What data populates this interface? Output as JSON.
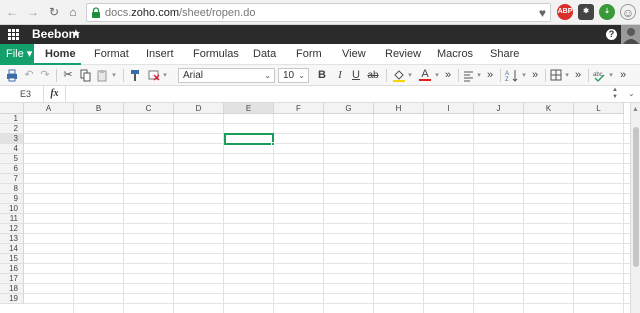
{
  "browser": {
    "url_prefix": "docs.",
    "url_host": "zoho.com",
    "url_path": "/sheet/ropen.do",
    "ext_abp": "ABP"
  },
  "app": {
    "workbook_name": "Beebom",
    "help_label": "?"
  },
  "menu": {
    "file_label": "File ▾",
    "tabs": [
      "Home",
      "Format",
      "Insert",
      "Formulas",
      "Data",
      "Form",
      "View",
      "Review",
      "Macros",
      "Share"
    ],
    "active_tab": "Home"
  },
  "toolbar": {
    "font_name": "Arial",
    "font_size": "10",
    "bold": "B",
    "italic": "I",
    "underline": "U",
    "strike": "ab",
    "font_color": "A"
  },
  "formula_bar": {
    "name_box": "E3",
    "fx_label": "fx",
    "formula": ""
  },
  "grid": {
    "columns": [
      "A",
      "B",
      "C",
      "D",
      "E",
      "F",
      "G",
      "H",
      "I",
      "J",
      "K",
      "L"
    ],
    "rows": [
      "1",
      "2",
      "3",
      "4",
      "5",
      "6",
      "7",
      "8",
      "9",
      "10",
      "11",
      "12",
      "13",
      "14",
      "15",
      "16",
      "17",
      "18",
      "19"
    ],
    "selected_cell": "E3"
  },
  "colors": {
    "accent": "#14a06b",
    "app_header": "#2b2b2b",
    "selection": "#1a9c5b"
  }
}
